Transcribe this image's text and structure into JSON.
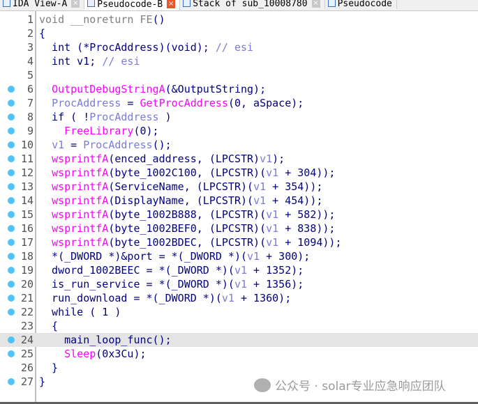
{
  "tabs": [
    {
      "label": "IDA View-A",
      "active": false
    },
    {
      "label": "Pseudocode-B",
      "active": true
    },
    {
      "label": "Stack of sub_10008780",
      "active": false
    },
    {
      "label": "Pseudocode",
      "active": false
    }
  ],
  "highlight_line": 24,
  "breakpoint_lines": [
    6,
    7,
    8,
    9,
    10,
    11,
    12,
    13,
    14,
    15,
    16,
    17,
    18,
    19,
    20,
    21,
    22,
    24,
    25,
    27
  ],
  "lines": [
    [
      [
        "void __noreturn FE",
        "g"
      ],
      [
        "()",
        "k"
      ]
    ],
    [
      [
        "{",
        "k"
      ]
    ],
    [
      [
        "  int (*ProcAddress)(void); ",
        "k"
      ],
      [
        "// esi",
        "c"
      ]
    ],
    [
      [
        "  int v1; ",
        "k"
      ],
      [
        "// esi",
        "c"
      ]
    ],
    [
      [
        "",
        ""
      ]
    ],
    [
      [
        "  ",
        "k"
      ],
      [
        "OutputDebugStringA",
        "f"
      ],
      [
        "(&OutputString);",
        "k"
      ]
    ],
    [
      [
        "  ",
        "k"
      ],
      [
        "ProcAddress",
        "v"
      ],
      [
        " = ",
        "k"
      ],
      [
        "GetProcAddress",
        "f"
      ],
      [
        "(0, aSpace);",
        "k"
      ]
    ],
    [
      [
        "  if ( !",
        "k"
      ],
      [
        "ProcAddress",
        "v"
      ],
      [
        " )",
        "k"
      ]
    ],
    [
      [
        "    ",
        "k"
      ],
      [
        "FreeLibrary",
        "f"
      ],
      [
        "(0);",
        "k"
      ]
    ],
    [
      [
        "  ",
        "k"
      ],
      [
        "v1",
        "v"
      ],
      [
        " = ",
        "k"
      ],
      [
        "ProcAddress",
        "v"
      ],
      [
        "();",
        "k"
      ]
    ],
    [
      [
        "  ",
        "k"
      ],
      [
        "wsprintfA",
        "f"
      ],
      [
        "(enced_address, (LPCSTR)",
        "k"
      ],
      [
        "v1",
        "v"
      ],
      [
        ");",
        "k"
      ]
    ],
    [
      [
        "  ",
        "k"
      ],
      [
        "wsprintfA",
        "f"
      ],
      [
        "(byte_1002C100, (LPCSTR)(",
        "k"
      ],
      [
        "v1",
        "v"
      ],
      [
        " + 304));",
        "k"
      ]
    ],
    [
      [
        "  ",
        "k"
      ],
      [
        "wsprintfA",
        "f"
      ],
      [
        "(ServiceName, (LPCSTR)(",
        "k"
      ],
      [
        "v1",
        "v"
      ],
      [
        " + 354));",
        "k"
      ]
    ],
    [
      [
        "  ",
        "k"
      ],
      [
        "wsprintfA",
        "f"
      ],
      [
        "(DisplayName, (LPCSTR)(",
        "k"
      ],
      [
        "v1",
        "v"
      ],
      [
        " + 454));",
        "k"
      ]
    ],
    [
      [
        "  ",
        "k"
      ],
      [
        "wsprintfA",
        "f"
      ],
      [
        "(byte_1002B888, (LPCSTR)(",
        "k"
      ],
      [
        "v1",
        "v"
      ],
      [
        " + 582));",
        "k"
      ]
    ],
    [
      [
        "  ",
        "k"
      ],
      [
        "wsprintfA",
        "f"
      ],
      [
        "(byte_1002BEF0, (LPCSTR)(",
        "k"
      ],
      [
        "v1",
        "v"
      ],
      [
        " + 838));",
        "k"
      ]
    ],
    [
      [
        "  ",
        "k"
      ],
      [
        "wsprintfA",
        "f"
      ],
      [
        "(byte_1002BDEC, (LPCSTR)(",
        "k"
      ],
      [
        "v1",
        "v"
      ],
      [
        " + 1094));",
        "k"
      ]
    ],
    [
      [
        "  *(_DWORD *)&port = *(_DWORD *)(",
        "k"
      ],
      [
        "v1",
        "v"
      ],
      [
        " + 300);",
        "k"
      ]
    ],
    [
      [
        "  dword_1002BEEC = *(_DWORD *)(",
        "k"
      ],
      [
        "v1",
        "v"
      ],
      [
        " + 1352);",
        "k"
      ]
    ],
    [
      [
        "  is_run_service = *(_DWORD *)(",
        "k"
      ],
      [
        "v1",
        "v"
      ],
      [
        " + 1356);",
        "k"
      ]
    ],
    [
      [
        "  run_download = *(_DWORD *)(",
        "k"
      ],
      [
        "v1",
        "v"
      ],
      [
        " + 1360);",
        "k"
      ]
    ],
    [
      [
        "  while ( 1 )",
        "k"
      ]
    ],
    [
      [
        "  {",
        "k"
      ]
    ],
    [
      [
        "    main_loop_func();",
        "k"
      ]
    ],
    [
      [
        "    ",
        "k"
      ],
      [
        "Sleep",
        "f"
      ],
      [
        "(0x3Cu);",
        "k"
      ]
    ],
    [
      [
        "  }",
        "k"
      ]
    ],
    [
      [
        "}",
        "k"
      ]
    ]
  ],
  "watermark": "公众号 · solar专业应急响应团队"
}
